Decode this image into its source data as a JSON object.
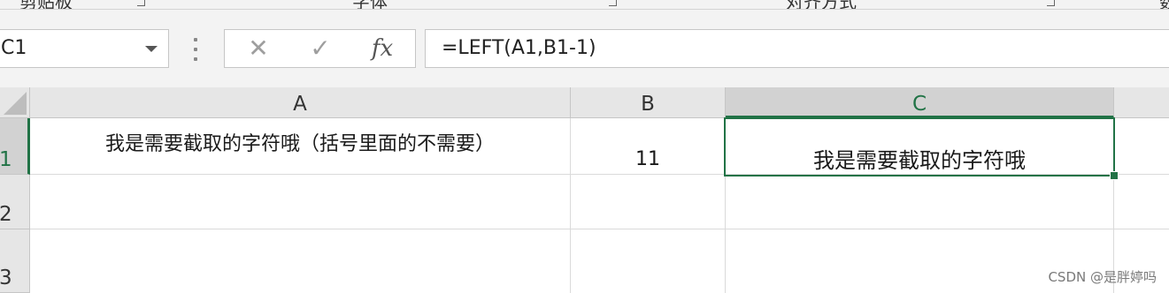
{
  "ribbon": {
    "groups": [
      "剪贴板",
      "字体",
      "对齐方式",
      "数"
    ]
  },
  "formula_bar": {
    "name_box": "C1",
    "cancel_glyph": "✕",
    "enter_glyph": "✓",
    "fx_glyph": "fx",
    "formula": "=LEFT(A1,B1-1)"
  },
  "sheet": {
    "columns": [
      "A",
      "B",
      "C"
    ],
    "selected_column": "C",
    "rows": [
      "1",
      "2",
      "3"
    ],
    "selected_row": "1",
    "cells": {
      "A1": "我是需要截取的字符哦（括号里面的不需要）",
      "B1": "11",
      "C1": "我是需要截取的字符哦"
    },
    "active_cell": "C1"
  },
  "watermark": "CSDN @是胖婷吗"
}
